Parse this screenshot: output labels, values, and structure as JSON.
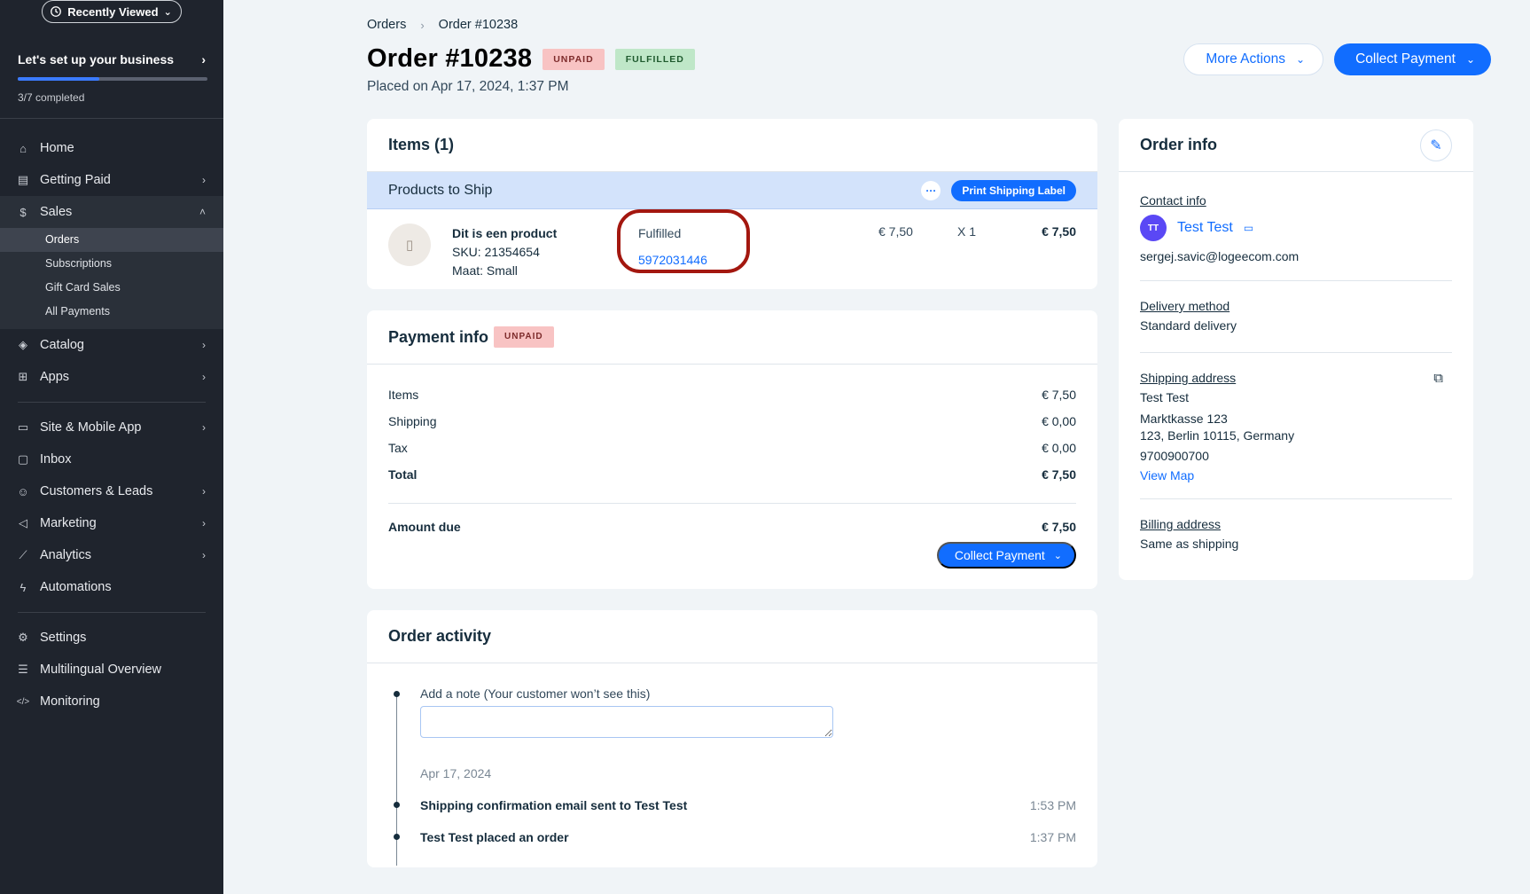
{
  "sidebar": {
    "recently_viewed": "Recently Viewed",
    "setup": {
      "title": "Let's set up your business",
      "completed": "3/7 completed",
      "progress": 0.43
    },
    "items": [
      {
        "label": "Home",
        "icon": "home-icon"
      },
      {
        "label": "Getting Paid",
        "icon": "getting-paid-icon"
      },
      {
        "label": "Sales",
        "icon": "sales-icon"
      }
    ],
    "sales_sub": [
      "Orders",
      "Subscriptions",
      "Gift Card Sales",
      "All Payments"
    ],
    "items2": [
      {
        "label": "Catalog",
        "icon": "catalog-icon"
      },
      {
        "label": "Apps",
        "icon": "apps-icon"
      }
    ],
    "items3": [
      {
        "label": "Site & Mobile App",
        "icon": "site-icon"
      },
      {
        "label": "Inbox",
        "icon": "inbox-icon"
      },
      {
        "label": "Customers & Leads",
        "icon": "customers-icon"
      },
      {
        "label": "Marketing",
        "icon": "marketing-icon"
      },
      {
        "label": "Analytics",
        "icon": "analytics-icon"
      },
      {
        "label": "Automations",
        "icon": "automations-icon"
      }
    ],
    "items4": [
      {
        "label": "Settings",
        "icon": "settings-icon"
      },
      {
        "label": "Multilingual Overview",
        "icon": "multilingual-icon"
      },
      {
        "label": "Monitoring",
        "icon": "monitoring-icon"
      }
    ]
  },
  "breadcrumb": {
    "root": "Orders",
    "current": "Order #10238"
  },
  "header": {
    "title": "Order #10238",
    "badge_unpaid": "UNPAID",
    "badge_fulfilled": "FULFILLED",
    "placed": "Placed on Apr 17, 2024, 1:37 PM",
    "more_actions": "More Actions",
    "collect_payment": "Collect Payment"
  },
  "items_card": {
    "title": "Items (1)",
    "section": "Products to Ship",
    "print_label": "Print Shipping Label",
    "product": {
      "name": "Dit is een product",
      "sku": "SKU: 21354654",
      "variant": "Maat: Small",
      "status": "Fulfilled",
      "tracking": "5972031446",
      "price": "€ 7,50",
      "qty": "X 1",
      "total": "€ 7,50"
    }
  },
  "payment": {
    "title": "Payment info",
    "badge": "UNPAID",
    "rows": [
      {
        "label": "Items",
        "value": "€ 7,50"
      },
      {
        "label": "Shipping",
        "value": "€ 0,00"
      },
      {
        "label": "Tax",
        "value": "€ 0,00"
      },
      {
        "label": "Total",
        "value": "€ 7,50"
      }
    ],
    "amount_due_label": "Amount due",
    "amount_due": "€ 7,50",
    "collect": "Collect Payment"
  },
  "activity": {
    "title": "Order activity",
    "note_label": "Add a note (Your customer won’t see this)",
    "date": "Apr 17, 2024",
    "events": [
      {
        "text": "Shipping confirmation email sent to Test Test",
        "time": "1:53 PM"
      },
      {
        "text": "Test Test placed an order",
        "time": "1:37 PM"
      }
    ]
  },
  "order_info": {
    "title": "Order info",
    "contact_h": "Contact info",
    "initials": "TT",
    "name": "Test Test",
    "email": "sergej.savic@logeecom.com",
    "delivery_h": "Delivery method",
    "delivery": "Standard delivery",
    "shipping_h": "Shipping address",
    "ship_name": "Test Test",
    "ship_street": "Marktkasse 123",
    "ship_city": "123, Berlin 10115, Germany",
    "ship_phone": "9700900700",
    "view_map": "View Map",
    "billing_h": "Billing address",
    "billing": "Same as shipping"
  }
}
